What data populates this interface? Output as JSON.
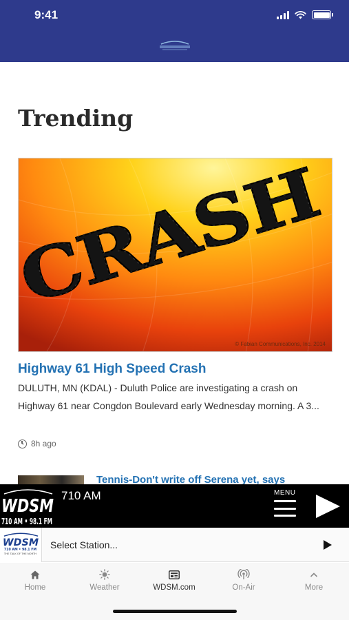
{
  "status_bar": {
    "time": "9:41"
  },
  "header": {
    "logo": "wdsm-logo"
  },
  "section": {
    "title": "Trending"
  },
  "article": {
    "image_text": "CRASH",
    "image_credit": "© Fabian Communications, Inc. 2014",
    "title": "Highway 61 High Speed Crash",
    "excerpt": "DULUTH, MN (KDAL) - Duluth Police are investigating a crash on Highway 61 near Congdon Boulevard early Wednesday morning. A 3...",
    "time_ago": "8h ago"
  },
  "next_article": {
    "title": "Tennis-Don't write off Serena yet, says"
  },
  "player": {
    "logo_text": "WDSM",
    "logo_sub": "710 AM • 98.1 FM",
    "station": "710 AM",
    "menu_label": "MENU"
  },
  "selector": {
    "label": "Select Station...",
    "logo_text": "WDSM",
    "logo_sub": "710 AM • 98.1 FM",
    "logo_tagline": "THE TALK OF THE NORTH"
  },
  "tabs": [
    {
      "label": "Home",
      "icon": "home-icon"
    },
    {
      "label": "Weather",
      "icon": "sun-icon"
    },
    {
      "label": "WDSM.com",
      "icon": "news-icon"
    },
    {
      "label": "On-Air",
      "icon": "broadcast-icon"
    },
    {
      "label": "More",
      "icon": "chevron-up-icon"
    }
  ],
  "colors": {
    "header": "#2e3a8c",
    "link": "#2472b3",
    "player": "#000000"
  }
}
